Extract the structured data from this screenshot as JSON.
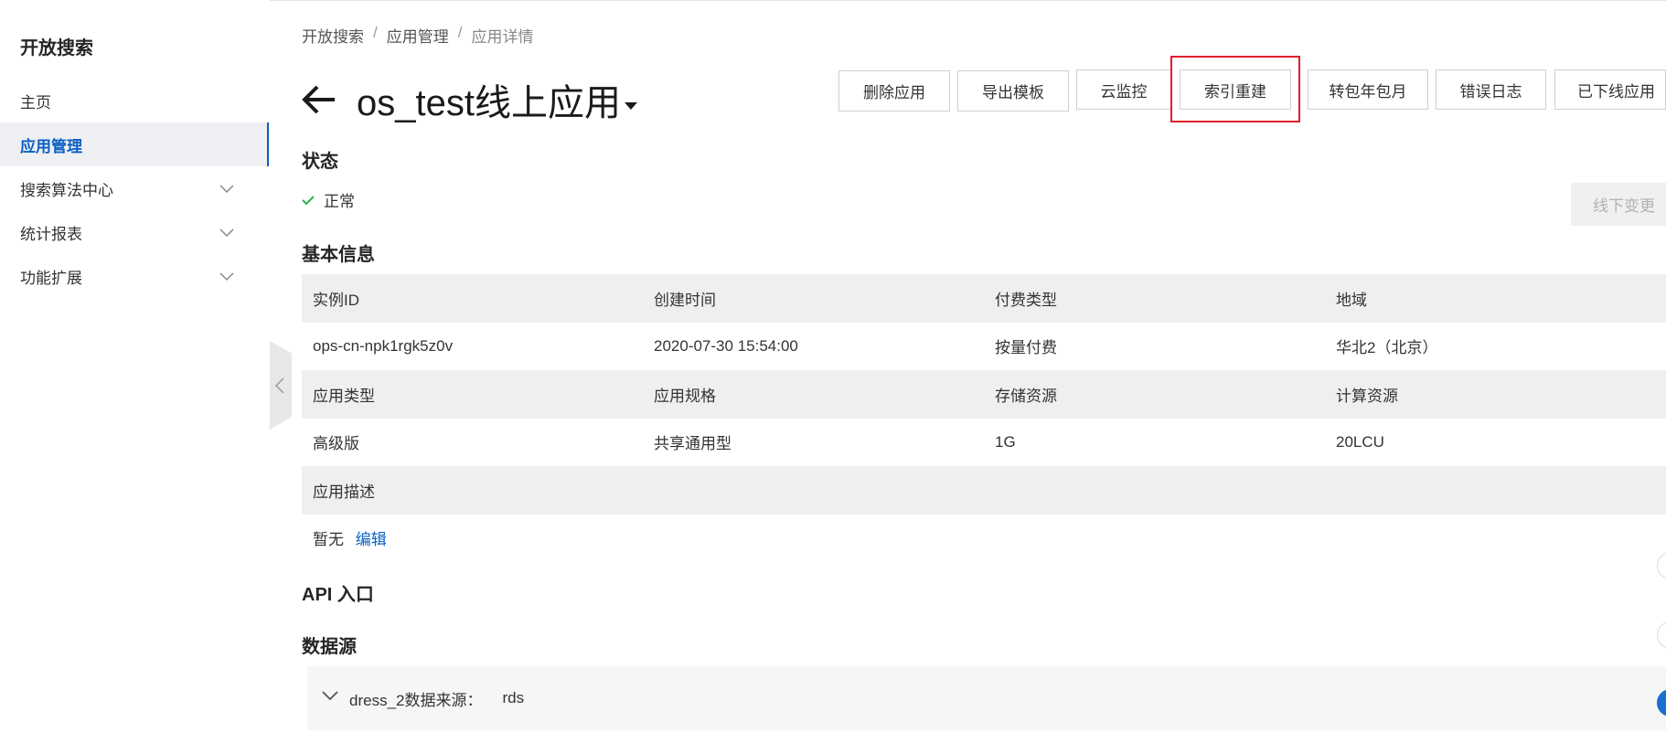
{
  "sidebar": {
    "title": "开放搜索",
    "items": [
      {
        "label": "主页",
        "active": false,
        "expandable": false
      },
      {
        "label": "应用管理",
        "active": true,
        "expandable": false
      },
      {
        "label": "搜索算法中心",
        "active": false,
        "expandable": true
      },
      {
        "label": "统计报表",
        "active": false,
        "expandable": true
      },
      {
        "label": "功能扩展",
        "active": false,
        "expandable": true
      }
    ]
  },
  "breadcrumb": {
    "items": [
      "开放搜索",
      "应用管理",
      "应用详情"
    ],
    "separator": "/"
  },
  "header": {
    "title": "os_test线上应用",
    "actions": [
      "删除应用",
      "导出模板",
      "云监控",
      "索引重建",
      "转包年包月",
      "错误日志",
      "已下线应用"
    ],
    "highlighted_action": "索引重建"
  },
  "status": {
    "section_title": "状态",
    "value": "正常",
    "offline_button": "线下变更"
  },
  "basic_info": {
    "section_title": "基本信息",
    "rows": [
      {
        "type": "head",
        "cells": [
          "实例ID",
          "创建时间",
          "付费类型",
          "地域"
        ]
      },
      {
        "type": "val",
        "cells": [
          "ops-cn-npk1rgk5z0v",
          "2020-07-30 15:54:00",
          "按量付费",
          "华北2（北京）"
        ]
      },
      {
        "type": "head",
        "cells": [
          "应用类型",
          "应用规格",
          "存储资源",
          "计算资源"
        ]
      },
      {
        "type": "val",
        "cells": [
          "高级版",
          "共享通用型",
          "1G",
          "20LCU"
        ]
      }
    ],
    "description_label": "应用描述",
    "description_value": "暂无",
    "edit_link": "编辑"
  },
  "api": {
    "section_title": "API 入口"
  },
  "datasource": {
    "section_title": "数据源",
    "item_label": "dress_2数据来源：",
    "item_value": "rds"
  },
  "colors": {
    "accent": "#0a5fc4",
    "highlight": "#e0202a",
    "success": "#2bb24c"
  }
}
